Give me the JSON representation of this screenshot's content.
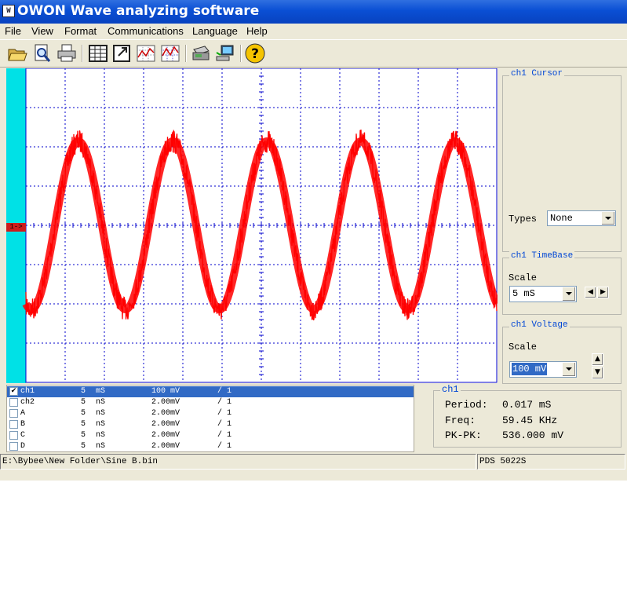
{
  "window": {
    "title": "OWON Wave analyzing software"
  },
  "menu": [
    "File",
    "View",
    "Format",
    "Communications",
    "Language",
    "Help"
  ],
  "toolbar": {
    "icons": [
      "open-folder-icon",
      "print-preview-icon",
      "print-icon",
      "table-icon",
      "export-icon",
      "waveform-chart-icon",
      "waveform-grid-icon",
      "scope-device-icon",
      "computer-connect-icon",
      "help-icon"
    ]
  },
  "scope": {
    "channel_marker": "1->",
    "trace_color": "#ff0000",
    "grid_color": "#0000cc",
    "left_bar_color": "#00e1e6"
  },
  "cursor_panel": {
    "title": "ch1 Cursor",
    "types_label": "Types",
    "types_value": "None"
  },
  "timebase_panel": {
    "title": "ch1 TimeBase",
    "scale_label": "Scale",
    "scale_value": "5  mS"
  },
  "voltage_panel": {
    "title": "ch1 Voltage",
    "scale_label": "Scale",
    "scale_value": "100 mV"
  },
  "channels": {
    "rows": [
      {
        "name": "ch1",
        "time": "5",
        "time_unit": "mS",
        "volt": "100 mV",
        "ratio": "/ 1",
        "checked": true,
        "selected": true
      },
      {
        "name": "ch2",
        "time": "5",
        "time_unit": "nS",
        "volt": "2.00mV",
        "ratio": "/ 1",
        "checked": false,
        "selected": false
      },
      {
        "name": "A",
        "time": "5",
        "time_unit": "nS",
        "volt": "2.00mV",
        "ratio": "/ 1",
        "checked": false,
        "selected": false
      },
      {
        "name": "B",
        "time": "5",
        "time_unit": "nS",
        "volt": "2.00mV",
        "ratio": "/ 1",
        "checked": false,
        "selected": false
      },
      {
        "name": "C",
        "time": "5",
        "time_unit": "nS",
        "volt": "2.00mV",
        "ratio": "/ 1",
        "checked": false,
        "selected": false
      },
      {
        "name": "D",
        "time": "5",
        "time_unit": "nS",
        "volt": "2.00mV",
        "ratio": "/ 1",
        "checked": false,
        "selected": false
      }
    ]
  },
  "measure": {
    "title": "ch1",
    "period_label": "Period:",
    "period_value": "0.017 mS",
    "freq_label": "Freq:",
    "freq_value": "59.45 KHz",
    "pkpk_label": "PK-PK:",
    "pkpk_value": "536.000 mV"
  },
  "status": {
    "file_path": "E:\\Bybee\\New Folder\\Sine B.bin",
    "device": "PDS 5022S"
  }
}
